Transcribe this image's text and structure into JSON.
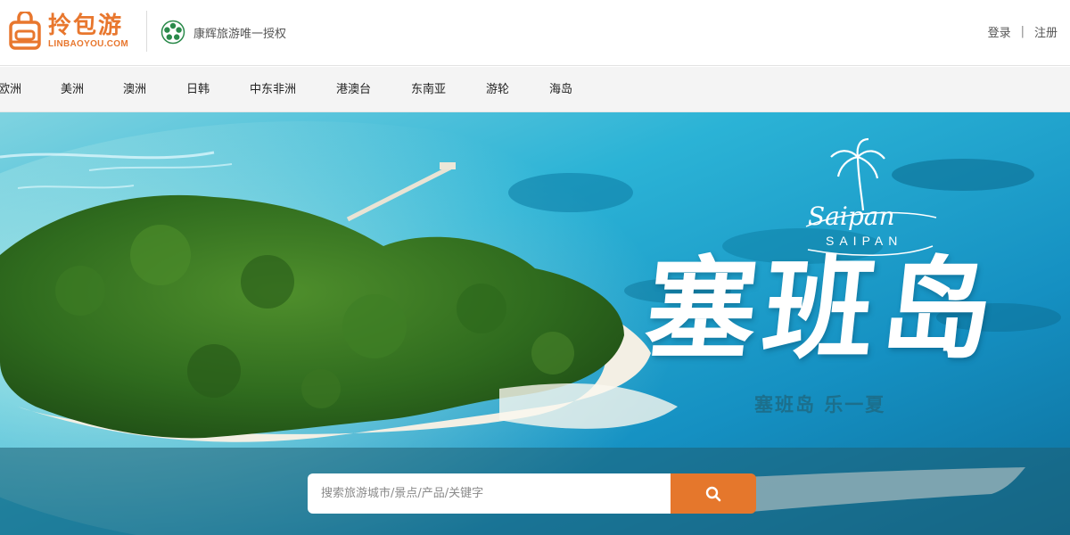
{
  "header": {
    "logo_cn": "拎包游",
    "logo_en": "LINBAOYOU.COM",
    "partner_text": "康辉旅游唯一授权",
    "login": "登录",
    "separator": "|",
    "register": "注册"
  },
  "nav": {
    "items": [
      {
        "label": "欧洲"
      },
      {
        "label": "美洲"
      },
      {
        "label": "澳洲"
      },
      {
        "label": "日韩"
      },
      {
        "label": "中东非洲"
      },
      {
        "label": "港澳台"
      },
      {
        "label": "东南亚"
      },
      {
        "label": "游轮"
      },
      {
        "label": "海岛"
      }
    ]
  },
  "banner": {
    "title": "塞班岛",
    "script_text": "Saipan",
    "caps_text": "SAIPAN",
    "slogan": "塞班岛  乐一夏"
  },
  "search": {
    "placeholder": "搜索旅游城市/景点/产品/关键字",
    "button_icon": "search-icon"
  },
  "colors": {
    "brand_orange": "#e5772c",
    "nav_bg": "#f4f4f4",
    "sea": "#1f9fc4"
  }
}
